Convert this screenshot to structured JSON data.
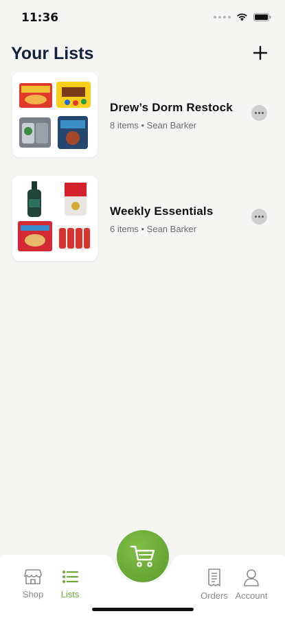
{
  "status_bar": {
    "time": "11:36"
  },
  "header": {
    "title": "Your Lists"
  },
  "lists": [
    {
      "name": "Drew’s Dorm Restock",
      "meta": "8 items • Sean Barker"
    },
    {
      "name": "Weekly Essentials",
      "meta": "6 items • Sean Barker"
    }
  ],
  "tabbar": {
    "tabs": [
      {
        "label": "Shop",
        "icon": "storefront-icon"
      },
      {
        "label": "Lists",
        "icon": "list-icon"
      },
      {
        "label": "Orders",
        "icon": "receipt-icon"
      },
      {
        "label": "Account",
        "icon": "person-icon"
      }
    ],
    "cart_icon": "cart-icon"
  },
  "colors": {
    "accent": "#6ea639",
    "title": "#14213d",
    "background": "#f5f5f3"
  }
}
